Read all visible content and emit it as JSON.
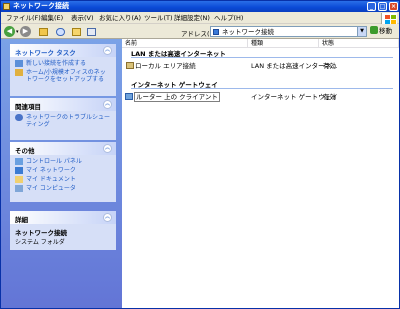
{
  "window": {
    "title": "ネットワーク接続"
  },
  "menu": [
    "ファイル(F)",
    "編集(E)",
    "表示(V)",
    "お気に入り(A)",
    "ツール(T)",
    "詳細設定(N)",
    "ヘルプ(H)"
  ],
  "address": {
    "label": "アドレス(D)",
    "value": "ネットワーク接続",
    "go": "移動"
  },
  "side": {
    "network_tasks": {
      "title": "ネットワーク タスク",
      "items": [
        "新しい接続を作成する",
        "ホーム/小規模オフィスのネットワークをセットアップする"
      ]
    },
    "related": {
      "title": "関連項目",
      "items": [
        "ネットワークのトラブルシューティング"
      ]
    },
    "other": {
      "title": "その他",
      "items": [
        "コントロール パネル",
        "マイ ネットワーク",
        "マイ ドキュメント",
        "マイ コンピュータ"
      ]
    },
    "details": {
      "title": "詳細",
      "name": "ネットワーク接続",
      "sub": "システム フォルダ"
    }
  },
  "columns": [
    "名前",
    "種類",
    "状態"
  ],
  "groups": [
    {
      "label": "LAN または高速インターネット",
      "rows": [
        {
          "name": "ローカル エリア接続",
          "type": "LAN または高速インターネ...",
          "status": "有効"
        }
      ]
    },
    {
      "label": "インターネット ゲートウェイ",
      "rows": [
        {
          "name": "ルーター 上の クライアント",
          "type": "インターネット ゲートウェイ",
          "status": "有効"
        }
      ]
    }
  ],
  "icons": {
    "titlebar": "folder-network-icon",
    "back": "back-arrow-icon",
    "forward": "forward-arrow-icon",
    "up": "up-folder-icon",
    "search": "search-icon",
    "folders": "folders-icon",
    "views": "views-icon",
    "go": "go-arrow-icon"
  },
  "colors": {
    "titlebar": "#0a49d6",
    "sidepane": "#7ba2e7",
    "link": "#215dc6"
  }
}
